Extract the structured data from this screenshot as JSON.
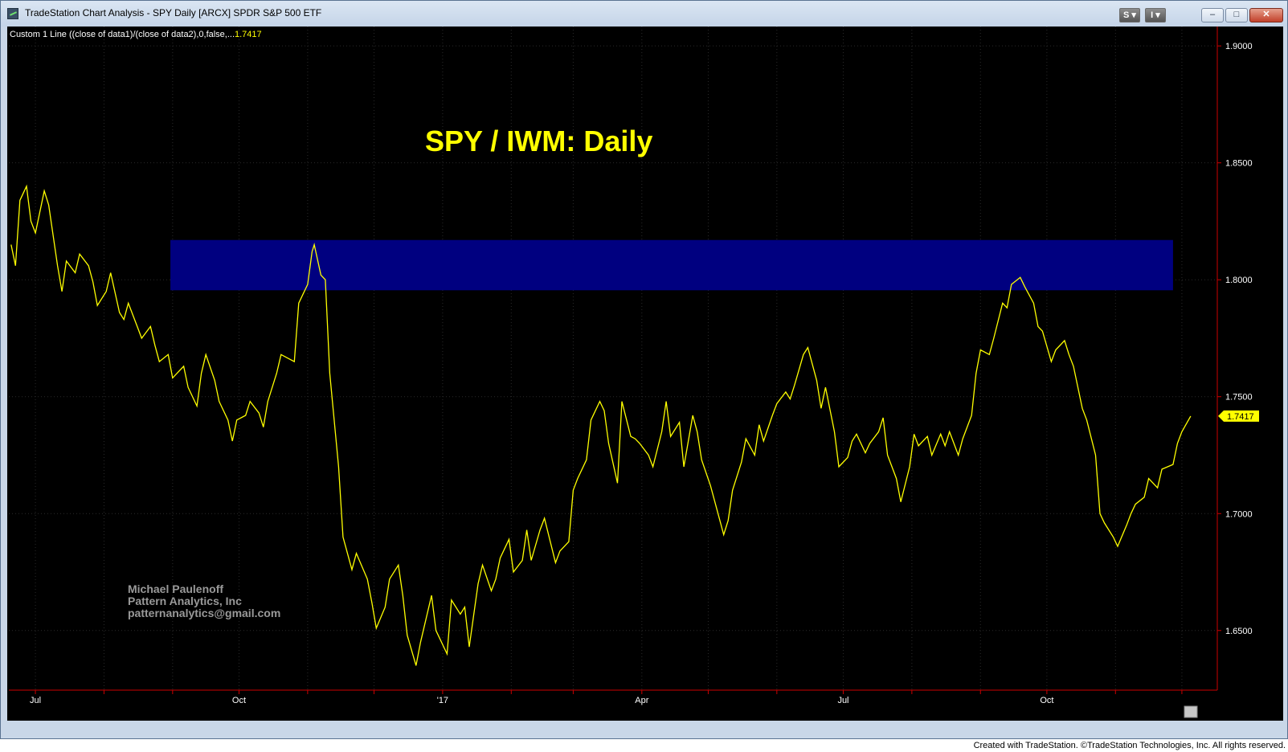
{
  "window": {
    "title": "TradeStation Chart Analysis - SPY Daily [ARCX] SPDR S&P 500 ETF",
    "buttons": {
      "s_label": "S",
      "i_label": "I",
      "minimize": "–",
      "maximize": "□",
      "close": "✕"
    }
  },
  "indicator": {
    "label": "Custom 1 Line ((close of data1)/(close of data2),0,false,...",
    "value": "1.7417",
    "value_color": "#ffff00"
  },
  "watermark": {
    "line1": "Michael Paulenoff",
    "line2": "Pattern Analytics, Inc",
    "line3": "patternanalytics@gmail.com"
  },
  "footer": "Created with TradeStation. ©TradeStation Technologies, Inc. All rights reserved.",
  "colors": {
    "background": "#000000",
    "line": "#ffff00",
    "band": "#000080",
    "grid": "#2a2a2a",
    "axis_red": "#cc0000",
    "title": "#ffff00",
    "watermark": "#999999"
  },
  "chart_data": {
    "type": "line",
    "title": "SPY / IWM: Daily",
    "xlabel": "",
    "ylabel": "",
    "ylim": [
      1.6245,
      1.9083
    ],
    "x_ticks": [
      {
        "label": "Jul",
        "date": "2016-07-01"
      },
      {
        "label": "Oct",
        "date": "2016-10-01"
      },
      {
        "label": "'17",
        "date": "2017-01-01"
      },
      {
        "label": "Apr",
        "date": "2017-04-01"
      },
      {
        "label": "Jul",
        "date": "2017-07-01"
      },
      {
        "label": "Oct",
        "date": "2017-10-01"
      }
    ],
    "y_ticks": [
      "1.6500",
      "1.7000",
      "1.7500",
      "1.8000",
      "1.8500",
      "1.9000"
    ],
    "last_value": 1.7417,
    "grid": true,
    "bands": [
      {
        "y_from": 1.7955,
        "y_to": 1.817,
        "x_from": "2016-08-31",
        "x_to": "2017-11-27"
      }
    ],
    "series": [
      {
        "points": [
          [
            "2016-06-20",
            1.815
          ],
          [
            "2016-06-22",
            1.806
          ],
          [
            "2016-06-24",
            1.834
          ],
          [
            "2016-06-27",
            1.84
          ],
          [
            "2016-06-29",
            1.825
          ],
          [
            "2016-07-01",
            1.82
          ],
          [
            "2016-07-05",
            1.838
          ],
          [
            "2016-07-07",
            1.832
          ],
          [
            "2016-07-11",
            1.806
          ],
          [
            "2016-07-13",
            1.795
          ],
          [
            "2016-07-15",
            1.808
          ],
          [
            "2016-07-19",
            1.803
          ],
          [
            "2016-07-21",
            1.811
          ],
          [
            "2016-07-25",
            1.806
          ],
          [
            "2016-07-27",
            1.799
          ],
          [
            "2016-07-29",
            1.789
          ],
          [
            "2016-08-02",
            1.795
          ],
          [
            "2016-08-04",
            1.803
          ],
          [
            "2016-08-08",
            1.786
          ],
          [
            "2016-08-10",
            1.783
          ],
          [
            "2016-08-12",
            1.79
          ],
          [
            "2016-08-16",
            1.78
          ],
          [
            "2016-08-18",
            1.775
          ],
          [
            "2016-08-22",
            1.78
          ],
          [
            "2016-08-24",
            1.772
          ],
          [
            "2016-08-26",
            1.765
          ],
          [
            "2016-08-30",
            1.768
          ],
          [
            "2016-09-01",
            1.758
          ],
          [
            "2016-09-06",
            1.763
          ],
          [
            "2016-09-08",
            1.754
          ],
          [
            "2016-09-12",
            1.746
          ],
          [
            "2016-09-14",
            1.76
          ],
          [
            "2016-09-16",
            1.768
          ],
          [
            "2016-09-20",
            1.757
          ],
          [
            "2016-09-22",
            1.748
          ],
          [
            "2016-09-26",
            1.74
          ],
          [
            "2016-09-28",
            1.731
          ],
          [
            "2016-09-30",
            1.74
          ],
          [
            "2016-10-04",
            1.742
          ],
          [
            "2016-10-06",
            1.748
          ],
          [
            "2016-10-10",
            1.743
          ],
          [
            "2016-10-12",
            1.737
          ],
          [
            "2016-10-14",
            1.748
          ],
          [
            "2016-10-18",
            1.76
          ],
          [
            "2016-10-20",
            1.768
          ],
          [
            "2016-10-24",
            1.766
          ],
          [
            "2016-10-26",
            1.765
          ],
          [
            "2016-10-28",
            1.79
          ],
          [
            "2016-11-01",
            1.798
          ],
          [
            "2016-11-03",
            1.812
          ],
          [
            "2016-11-04",
            1.815
          ],
          [
            "2016-11-07",
            1.802
          ],
          [
            "2016-11-09",
            1.8
          ],
          [
            "2016-11-11",
            1.76
          ],
          [
            "2016-11-15",
            1.72
          ],
          [
            "2016-11-17",
            1.69
          ],
          [
            "2016-11-21",
            1.676
          ],
          [
            "2016-11-23",
            1.683
          ],
          [
            "2016-11-28",
            1.672
          ],
          [
            "2016-11-30",
            1.662
          ],
          [
            "2016-12-02",
            1.651
          ],
          [
            "2016-12-06",
            1.66
          ],
          [
            "2016-12-08",
            1.672
          ],
          [
            "2016-12-12",
            1.678
          ],
          [
            "2016-12-14",
            1.665
          ],
          [
            "2016-12-16",
            1.648
          ],
          [
            "2016-12-20",
            1.635
          ],
          [
            "2016-12-22",
            1.645
          ],
          [
            "2016-12-27",
            1.665
          ],
          [
            "2016-12-29",
            1.65
          ],
          [
            "2017-01-03",
            1.64
          ],
          [
            "2017-01-05",
            1.663
          ],
          [
            "2017-01-09",
            1.657
          ],
          [
            "2017-01-11",
            1.66
          ],
          [
            "2017-01-13",
            1.643
          ],
          [
            "2017-01-17",
            1.67
          ],
          [
            "2017-01-19",
            1.678
          ],
          [
            "2017-01-23",
            1.667
          ],
          [
            "2017-01-25",
            1.672
          ],
          [
            "2017-01-27",
            1.681
          ],
          [
            "2017-01-31",
            1.689
          ],
          [
            "2017-02-02",
            1.675
          ],
          [
            "2017-02-06",
            1.68
          ],
          [
            "2017-02-08",
            1.693
          ],
          [
            "2017-02-10",
            1.68
          ],
          [
            "2017-02-14",
            1.693
          ],
          [
            "2017-02-16",
            1.698
          ],
          [
            "2017-02-21",
            1.679
          ],
          [
            "2017-02-23",
            1.684
          ],
          [
            "2017-02-27",
            1.688
          ],
          [
            "2017-03-01",
            1.71
          ],
          [
            "2017-03-03",
            1.715
          ],
          [
            "2017-03-07",
            1.723
          ],
          [
            "2017-03-09",
            1.74
          ],
          [
            "2017-03-13",
            1.748
          ],
          [
            "2017-03-15",
            1.744
          ],
          [
            "2017-03-17",
            1.73
          ],
          [
            "2017-03-21",
            1.713
          ],
          [
            "2017-03-23",
            1.748
          ],
          [
            "2017-03-27",
            1.733
          ],
          [
            "2017-03-29",
            1.732
          ],
          [
            "2017-03-31",
            1.73
          ],
          [
            "2017-04-04",
            1.725
          ],
          [
            "2017-04-06",
            1.72
          ],
          [
            "2017-04-10",
            1.735
          ],
          [
            "2017-04-12",
            1.748
          ],
          [
            "2017-04-14",
            1.733
          ],
          [
            "2017-04-18",
            1.739
          ],
          [
            "2017-04-20",
            1.72
          ],
          [
            "2017-04-24",
            1.742
          ],
          [
            "2017-04-26",
            1.735
          ],
          [
            "2017-04-28",
            1.723
          ],
          [
            "2017-05-02",
            1.712
          ],
          [
            "2017-05-04",
            1.705
          ],
          [
            "2017-05-08",
            1.691
          ],
          [
            "2017-05-10",
            1.697
          ],
          [
            "2017-05-12",
            1.71
          ],
          [
            "2017-05-16",
            1.722
          ],
          [
            "2017-05-18",
            1.732
          ],
          [
            "2017-05-22",
            1.725
          ],
          [
            "2017-05-24",
            1.738
          ],
          [
            "2017-05-26",
            1.731
          ],
          [
            "2017-05-30",
            1.742
          ],
          [
            "2017-06-01",
            1.747
          ],
          [
            "2017-06-05",
            1.752
          ],
          [
            "2017-06-07",
            1.749
          ],
          [
            "2017-06-09",
            1.755
          ],
          [
            "2017-06-13",
            1.768
          ],
          [
            "2017-06-15",
            1.771
          ],
          [
            "2017-06-19",
            1.757
          ],
          [
            "2017-06-21",
            1.745
          ],
          [
            "2017-06-23",
            1.754
          ],
          [
            "2017-06-27",
            1.735
          ],
          [
            "2017-06-29",
            1.72
          ],
          [
            "2017-07-03",
            1.724
          ],
          [
            "2017-07-05",
            1.731
          ],
          [
            "2017-07-07",
            1.734
          ],
          [
            "2017-07-11",
            1.726
          ],
          [
            "2017-07-13",
            1.73
          ],
          [
            "2017-07-17",
            1.735
          ],
          [
            "2017-07-19",
            1.741
          ],
          [
            "2017-07-21",
            1.725
          ],
          [
            "2017-07-25",
            1.715
          ],
          [
            "2017-07-27",
            1.705
          ],
          [
            "2017-07-31",
            1.72
          ],
          [
            "2017-08-02",
            1.734
          ],
          [
            "2017-08-04",
            1.729
          ],
          [
            "2017-08-08",
            1.733
          ],
          [
            "2017-08-10",
            1.725
          ],
          [
            "2017-08-14",
            1.734
          ],
          [
            "2017-08-16",
            1.729
          ],
          [
            "2017-08-18",
            1.735
          ],
          [
            "2017-08-22",
            1.725
          ],
          [
            "2017-08-24",
            1.732
          ],
          [
            "2017-08-28",
            1.742
          ],
          [
            "2017-08-30",
            1.76
          ],
          [
            "2017-09-01",
            1.77
          ],
          [
            "2017-09-05",
            1.768
          ],
          [
            "2017-09-07",
            1.775
          ],
          [
            "2017-09-11",
            1.79
          ],
          [
            "2017-09-13",
            1.788
          ],
          [
            "2017-09-15",
            1.798
          ],
          [
            "2017-09-19",
            1.801
          ],
          [
            "2017-09-21",
            1.797
          ],
          [
            "2017-09-25",
            1.79
          ],
          [
            "2017-09-27",
            1.78
          ],
          [
            "2017-09-29",
            1.778
          ],
          [
            "2017-10-03",
            1.765
          ],
          [
            "2017-10-05",
            1.77
          ],
          [
            "2017-10-09",
            1.774
          ],
          [
            "2017-10-11",
            1.768
          ],
          [
            "2017-10-13",
            1.763
          ],
          [
            "2017-10-17",
            1.745
          ],
          [
            "2017-10-19",
            1.74
          ],
          [
            "2017-10-23",
            1.725
          ],
          [
            "2017-10-25",
            1.7
          ],
          [
            "2017-10-27",
            1.696
          ],
          [
            "2017-10-31",
            1.69
          ],
          [
            "2017-11-02",
            1.686
          ],
          [
            "2017-11-06",
            1.695
          ],
          [
            "2017-11-08",
            1.7
          ],
          [
            "2017-11-10",
            1.704
          ],
          [
            "2017-11-14",
            1.707
          ],
          [
            "2017-11-16",
            1.715
          ],
          [
            "2017-11-20",
            1.711
          ],
          [
            "2017-11-22",
            1.719
          ],
          [
            "2017-11-27",
            1.721
          ],
          [
            "2017-11-29",
            1.73
          ],
          [
            "2017-12-01",
            1.735
          ],
          [
            "2017-12-05",
            1.7417
          ]
        ]
      }
    ]
  }
}
